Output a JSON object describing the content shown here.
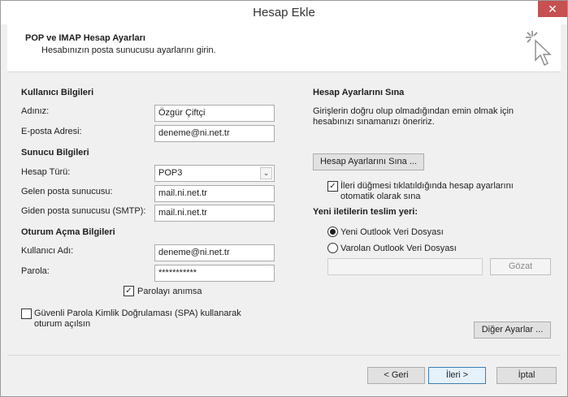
{
  "window": {
    "title": "Hesap Ekle",
    "close": "✕"
  },
  "header": {
    "title": "POP ve IMAP Hesap Ayarları",
    "subtitle": "Hesabınızın posta sunucusu ayarlarını girin."
  },
  "user_info": {
    "heading": "Kullanıcı Bilgileri",
    "name_label": "Adınız:",
    "name_value": "Özgür Çiftçi",
    "email_label": "E-posta Adresi:",
    "email_value": "deneme@ni.net.tr"
  },
  "server_info": {
    "heading": "Sunucu Bilgileri",
    "account_type_label": "Hesap Türü:",
    "account_type_value": "POP3",
    "incoming_label": "Gelen posta sunucusu:",
    "incoming_value": "mail.ni.net.tr",
    "outgoing_label": "Giden posta sunucusu (SMTP):",
    "outgoing_value": "mail.ni.net.tr"
  },
  "logon_info": {
    "heading": "Oturum Açma Bilgileri",
    "username_label": "Kullanıcı Adı:",
    "username_value": "deneme@ni.net.tr",
    "password_label": "Parola:",
    "password_value": "***********",
    "remember_label": "Parolayı anımsa",
    "remember_checked": true,
    "spa_label_line1": "Güvenli Parola Kimlik Doğrulaması (SPA) kullanarak",
    "spa_label_line2": "oturum açılsın",
    "spa_checked": false
  },
  "test_settings": {
    "heading": "Hesap Ayarlarını Sına",
    "description_line1": "Girişlerin doğru olup olmadığından emin olmak için",
    "description_line2": "hesabınızı sınamanızı öneririz.",
    "test_button": "Hesap Ayarlarını Sına ...",
    "auto_test_line1": "İleri düğmesi tıklatıldığında hesap ayarlarını",
    "auto_test_line2": "otomatik olarak sına",
    "auto_test_checked": true
  },
  "delivery": {
    "heading": "Yeni iletilerin teslim yeri:",
    "option_new": "Yeni Outlook Veri Dosyası",
    "option_existing": "Varolan Outlook Veri Dosyası",
    "selected": "new",
    "path_value": "",
    "browse_button": "Gözat"
  },
  "more_settings_button": "Diğer Ayarlar ...",
  "footer": {
    "back_button": "< Geri",
    "next_button": "İleri >",
    "cancel_button": "İptal"
  },
  "check_glyph": "✓",
  "dropdown_glyph": "⌄"
}
